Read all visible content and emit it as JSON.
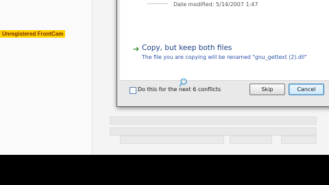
{
  "watermark": {
    "text": "Unregistered FrontCam"
  },
  "dialog": {
    "partial_text": "Date modified: 5/14/2007 1:47",
    "option": {
      "icon": "green-arrow-icon",
      "title": "Copy, but keep both files",
      "description": "The file you are copying will be renamed \"gnu_gettext (2).dll\""
    },
    "conflicts_checkbox": {
      "label": "Do this for the next 6 conflicts",
      "checked": false
    },
    "skip_label": "Skip",
    "cancel_label": "Cancel"
  },
  "colors": {
    "accent": "#1f3f84",
    "option_desc": "#2c52a8",
    "watermark_bg": "#ffd200"
  }
}
